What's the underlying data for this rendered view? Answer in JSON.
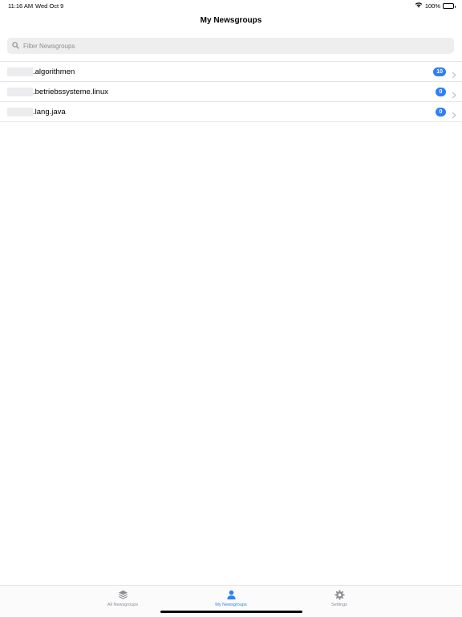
{
  "status": {
    "time": "11:16 AM",
    "date": "Wed Oct 9",
    "battery": "100%",
    "battery_level": 1.0
  },
  "nav": {
    "title": "My Newsgroups"
  },
  "search": {
    "placeholder": "Filter Newsgroups",
    "value": "",
    "icon": "search-icon"
  },
  "newsgroups": [
    {
      "label": ".algorithmen",
      "count": "10"
    },
    {
      "label": ".betriebssysteme.linux",
      "count": "0"
    },
    {
      "label": ".lang.java",
      "count": "0"
    }
  ],
  "tabs": [
    {
      "label": "All Newsgroups",
      "icon": "stack-icon",
      "active": false
    },
    {
      "label": "My Newsgroups",
      "icon": "person-icon",
      "active": true
    },
    {
      "label": "Settings",
      "icon": "gear-icon",
      "active": false
    }
  ],
  "colors": {
    "accent": "#2f7ff6",
    "inactive": "#8e8e93",
    "separator": "#e6e6e9"
  }
}
